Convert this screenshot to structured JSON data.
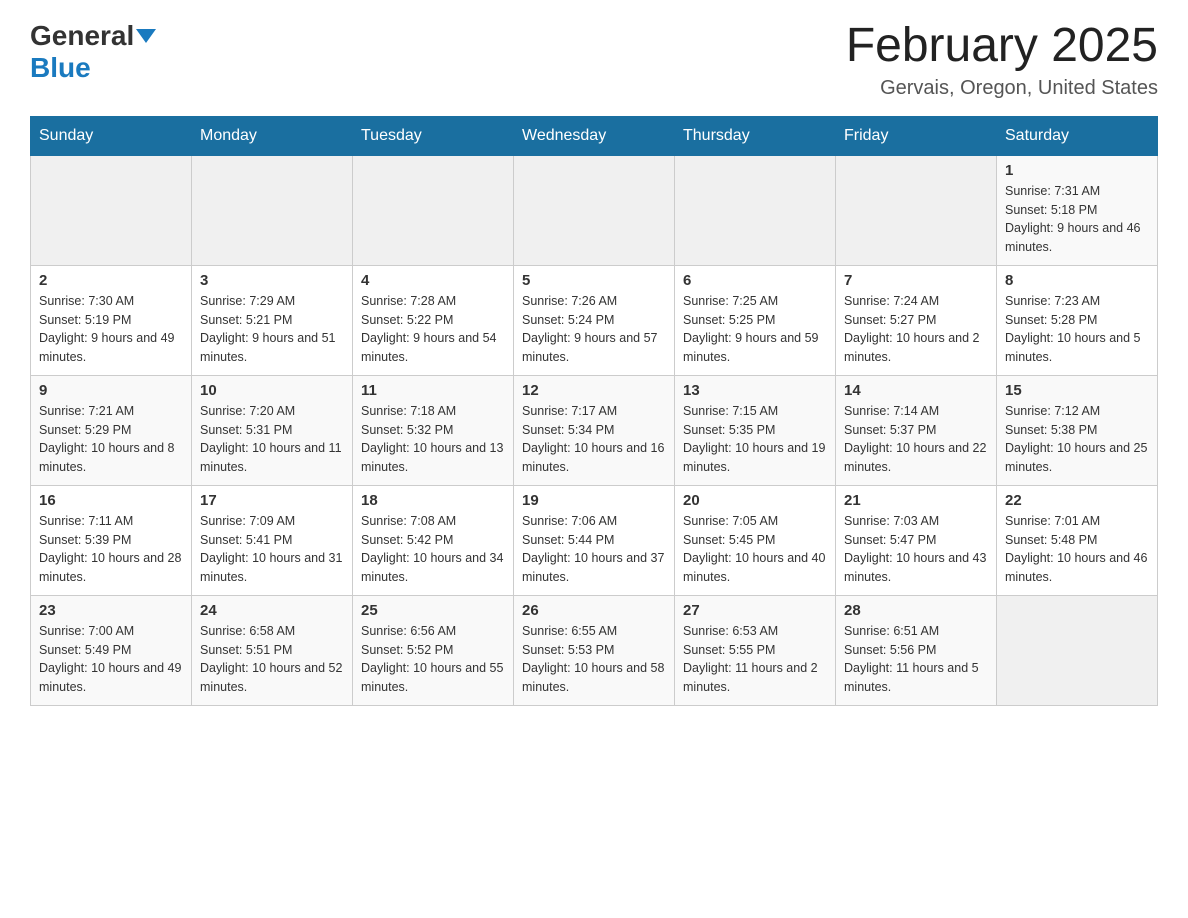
{
  "logo": {
    "general": "General",
    "blue": "Blue"
  },
  "header": {
    "title": "February 2025",
    "location": "Gervais, Oregon, United States"
  },
  "weekdays": [
    "Sunday",
    "Monday",
    "Tuesday",
    "Wednesday",
    "Thursday",
    "Friday",
    "Saturday"
  ],
  "weeks": [
    [
      {
        "day": "",
        "info": ""
      },
      {
        "day": "",
        "info": ""
      },
      {
        "day": "",
        "info": ""
      },
      {
        "day": "",
        "info": ""
      },
      {
        "day": "",
        "info": ""
      },
      {
        "day": "",
        "info": ""
      },
      {
        "day": "1",
        "info": "Sunrise: 7:31 AM\nSunset: 5:18 PM\nDaylight: 9 hours and 46 minutes."
      }
    ],
    [
      {
        "day": "2",
        "info": "Sunrise: 7:30 AM\nSunset: 5:19 PM\nDaylight: 9 hours and 49 minutes."
      },
      {
        "day": "3",
        "info": "Sunrise: 7:29 AM\nSunset: 5:21 PM\nDaylight: 9 hours and 51 minutes."
      },
      {
        "day": "4",
        "info": "Sunrise: 7:28 AM\nSunset: 5:22 PM\nDaylight: 9 hours and 54 minutes."
      },
      {
        "day": "5",
        "info": "Sunrise: 7:26 AM\nSunset: 5:24 PM\nDaylight: 9 hours and 57 minutes."
      },
      {
        "day": "6",
        "info": "Sunrise: 7:25 AM\nSunset: 5:25 PM\nDaylight: 9 hours and 59 minutes."
      },
      {
        "day": "7",
        "info": "Sunrise: 7:24 AM\nSunset: 5:27 PM\nDaylight: 10 hours and 2 minutes."
      },
      {
        "day": "8",
        "info": "Sunrise: 7:23 AM\nSunset: 5:28 PM\nDaylight: 10 hours and 5 minutes."
      }
    ],
    [
      {
        "day": "9",
        "info": "Sunrise: 7:21 AM\nSunset: 5:29 PM\nDaylight: 10 hours and 8 minutes."
      },
      {
        "day": "10",
        "info": "Sunrise: 7:20 AM\nSunset: 5:31 PM\nDaylight: 10 hours and 11 minutes."
      },
      {
        "day": "11",
        "info": "Sunrise: 7:18 AM\nSunset: 5:32 PM\nDaylight: 10 hours and 13 minutes."
      },
      {
        "day": "12",
        "info": "Sunrise: 7:17 AM\nSunset: 5:34 PM\nDaylight: 10 hours and 16 minutes."
      },
      {
        "day": "13",
        "info": "Sunrise: 7:15 AM\nSunset: 5:35 PM\nDaylight: 10 hours and 19 minutes."
      },
      {
        "day": "14",
        "info": "Sunrise: 7:14 AM\nSunset: 5:37 PM\nDaylight: 10 hours and 22 minutes."
      },
      {
        "day": "15",
        "info": "Sunrise: 7:12 AM\nSunset: 5:38 PM\nDaylight: 10 hours and 25 minutes."
      }
    ],
    [
      {
        "day": "16",
        "info": "Sunrise: 7:11 AM\nSunset: 5:39 PM\nDaylight: 10 hours and 28 minutes."
      },
      {
        "day": "17",
        "info": "Sunrise: 7:09 AM\nSunset: 5:41 PM\nDaylight: 10 hours and 31 minutes."
      },
      {
        "day": "18",
        "info": "Sunrise: 7:08 AM\nSunset: 5:42 PM\nDaylight: 10 hours and 34 minutes."
      },
      {
        "day": "19",
        "info": "Sunrise: 7:06 AM\nSunset: 5:44 PM\nDaylight: 10 hours and 37 minutes."
      },
      {
        "day": "20",
        "info": "Sunrise: 7:05 AM\nSunset: 5:45 PM\nDaylight: 10 hours and 40 minutes."
      },
      {
        "day": "21",
        "info": "Sunrise: 7:03 AM\nSunset: 5:47 PM\nDaylight: 10 hours and 43 minutes."
      },
      {
        "day": "22",
        "info": "Sunrise: 7:01 AM\nSunset: 5:48 PM\nDaylight: 10 hours and 46 minutes."
      }
    ],
    [
      {
        "day": "23",
        "info": "Sunrise: 7:00 AM\nSunset: 5:49 PM\nDaylight: 10 hours and 49 minutes."
      },
      {
        "day": "24",
        "info": "Sunrise: 6:58 AM\nSunset: 5:51 PM\nDaylight: 10 hours and 52 minutes."
      },
      {
        "day": "25",
        "info": "Sunrise: 6:56 AM\nSunset: 5:52 PM\nDaylight: 10 hours and 55 minutes."
      },
      {
        "day": "26",
        "info": "Sunrise: 6:55 AM\nSunset: 5:53 PM\nDaylight: 10 hours and 58 minutes."
      },
      {
        "day": "27",
        "info": "Sunrise: 6:53 AM\nSunset: 5:55 PM\nDaylight: 11 hours and 2 minutes."
      },
      {
        "day": "28",
        "info": "Sunrise: 6:51 AM\nSunset: 5:56 PM\nDaylight: 11 hours and 5 minutes."
      },
      {
        "day": "",
        "info": ""
      }
    ]
  ]
}
